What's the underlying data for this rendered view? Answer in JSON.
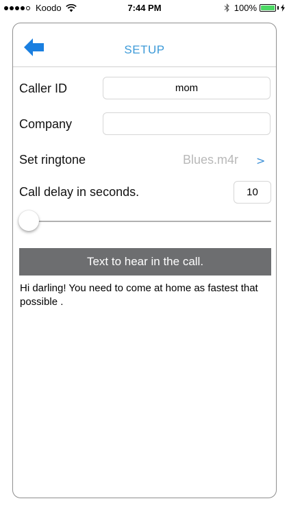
{
  "status_bar": {
    "carrier": "Koodo",
    "time": "7:44 PM",
    "battery": "100%",
    "battery_level": 1.0
  },
  "nav": {
    "title": "SETUP",
    "back_icon": "back-arrow-icon"
  },
  "form": {
    "caller_id": {
      "label": "Caller ID",
      "value": "mom"
    },
    "company": {
      "label": "Company",
      "value": ""
    },
    "ringtone": {
      "label": "Set ringtone",
      "value": "Blues.m4r",
      "chevron": ">"
    },
    "delay": {
      "label": "Call delay in seconds.",
      "value": "10"
    },
    "slider": {
      "value": 0
    }
  },
  "text_section": {
    "header": "Text to hear in the call.",
    "message": "Hi darling! You need to come at home as fastest that possible ."
  },
  "colors": {
    "accent": "#3c9ad8",
    "back_arrow": "#1a7fe0",
    "header_bar": "#6d6e70",
    "battery": "#4cd964"
  }
}
